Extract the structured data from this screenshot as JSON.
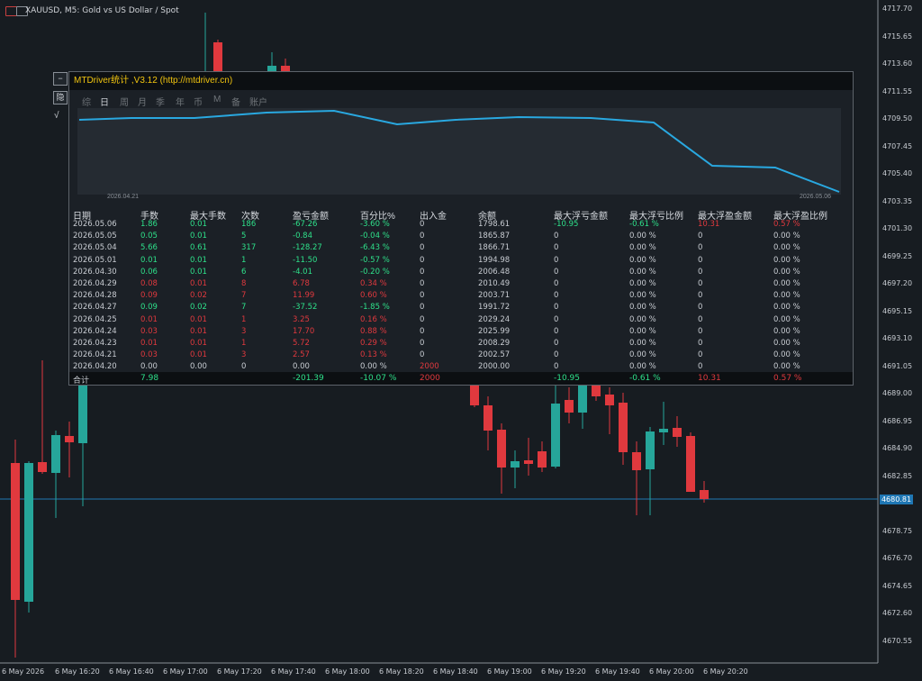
{
  "window": {
    "title": "XAUUSD, M5:  Gold vs US Dollar / Spot",
    "current_price": "4680.81"
  },
  "price_axis": [
    "4717.70",
    "4715.65",
    "4713.60",
    "4711.55",
    "4709.50",
    "4707.45",
    "4705.40",
    "4703.35",
    "4701.30",
    "4699.25",
    "4697.20",
    "4695.15",
    "4693.10",
    "4691.05",
    "4689.00",
    "4686.95",
    "4684.90",
    "4682.85",
    "4680.81",
    "4678.75",
    "4676.70",
    "4674.65",
    "4672.60",
    "4670.55"
  ],
  "time_axis": [
    "6 May 2026",
    "6 May 16:20",
    "6 May 16:40",
    "6 May 17:00",
    "6 May 17:20",
    "6 May 17:40",
    "6 May 18:00",
    "6 May 18:20",
    "6 May 18:40",
    "6 May 19:00",
    "6 May 19:20",
    "6 May 19:40",
    "6 May 20:00",
    "6 May 20:20"
  ],
  "side_buttons": {
    "minimize": "−",
    "hide": "隐",
    "check": "√"
  },
  "panel": {
    "title": "MTDriver统计 ,V3.12 (http://mtdriver.cn)",
    "tabs": [
      "综",
      "日",
      "周",
      "月",
      "季",
      "年",
      "币",
      "M",
      "备",
      "账户"
    ],
    "active_tab": "日",
    "graph": {
      "start_date": "2026.04.21",
      "end_date": "2026.05.06"
    },
    "headers": [
      "日期",
      "手数",
      "最大手数",
      "次数",
      "盈亏金额",
      "百分比%",
      "出入金",
      "余额",
      "最大浮亏金额",
      "最大浮亏比例",
      "最大浮盈金额",
      "最大浮盈比例"
    ],
    "rows": [
      [
        "2026.05.06",
        "1.86",
        "0.01",
        "186",
        "-67.26",
        "-3.60 %",
        "0",
        "1798.61",
        "-10.95",
        "-0.61 %",
        "10.31",
        "0.57 %"
      ],
      [
        "2026.05.05",
        "0.05",
        "0.01",
        "5",
        "-0.84",
        "-0.04 %",
        "0",
        "1865.87",
        "0",
        "0.00 %",
        "0",
        "0.00 %"
      ],
      [
        "2026.05.04",
        "5.66",
        "0.61",
        "317",
        "-128.27",
        "-6.43 %",
        "0",
        "1866.71",
        "0",
        "0.00 %",
        "0",
        "0.00 %"
      ],
      [
        "2026.05.01",
        "0.01",
        "0.01",
        "1",
        "-11.50",
        "-0.57 %",
        "0",
        "1994.98",
        "0",
        "0.00 %",
        "0",
        "0.00 %"
      ],
      [
        "2026.04.30",
        "0.06",
        "0.01",
        "6",
        "-4.01",
        "-0.20 %",
        "0",
        "2006.48",
        "0",
        "0.00 %",
        "0",
        "0.00 %"
      ],
      [
        "2026.04.29",
        "0.08",
        "0.01",
        "8",
        "6.78",
        "0.34 %",
        "0",
        "2010.49",
        "0",
        "0.00 %",
        "0",
        "0.00 %"
      ],
      [
        "2026.04.28",
        "0.09",
        "0.02",
        "7",
        "11.99",
        "0.60 %",
        "0",
        "2003.71",
        "0",
        "0.00 %",
        "0",
        "0.00 %"
      ],
      [
        "2026.04.27",
        "0.09",
        "0.02",
        "7",
        "-37.52",
        "-1.85 %",
        "0",
        "1991.72",
        "0",
        "0.00 %",
        "0",
        "0.00 %"
      ],
      [
        "2026.04.25",
        "0.01",
        "0.01",
        "1",
        "3.25",
        "0.16 %",
        "0",
        "2029.24",
        "0",
        "0.00 %",
        "0",
        "0.00 %"
      ],
      [
        "2026.04.24",
        "0.03",
        "0.01",
        "3",
        "17.70",
        "0.88 %",
        "0",
        "2025.99",
        "0",
        "0.00 %",
        "0",
        "0.00 %"
      ],
      [
        "2026.04.23",
        "0.01",
        "0.01",
        "1",
        "5.72",
        "0.29 %",
        "0",
        "2008.29",
        "0",
        "0.00 %",
        "0",
        "0.00 %"
      ],
      [
        "2026.04.21",
        "0.03",
        "0.01",
        "3",
        "2.57",
        "0.13 %",
        "0",
        "2002.57",
        "0",
        "0.00 %",
        "0",
        "0.00 %"
      ],
      [
        "2026.04.20",
        "0.00",
        "0.00",
        "0",
        "0.00",
        "0.00 %",
        "2000",
        "2000.00",
        "0",
        "0.00 %",
        "0",
        "0.00 %"
      ]
    ],
    "total": [
      "合计",
      "7.98",
      "",
      "",
      "-201.39",
      "-10.07 %",
      "2000",
      "",
      "-10.95",
      "-0.61 %",
      "10.31",
      "0.57 %"
    ]
  },
  "colors": {
    "background": "#171c21",
    "bull": "#26a69a",
    "bear": "#e0393e",
    "equity_line": "#29a8e0",
    "profit": "#2ee08a",
    "loss": "#e0393e",
    "title": "#f1c40f"
  }
}
